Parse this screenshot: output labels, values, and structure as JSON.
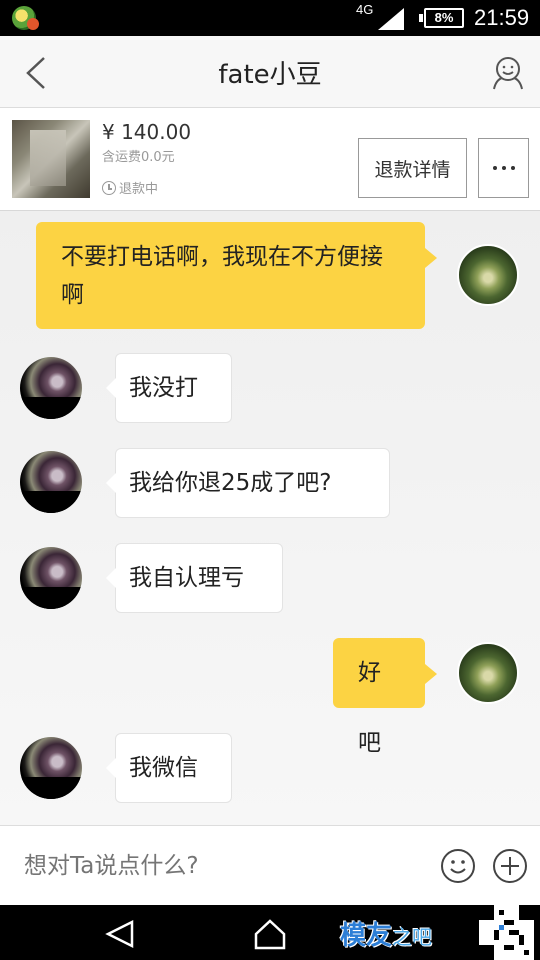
{
  "status_bar": {
    "network": "4G",
    "battery": "8%",
    "time": "21:59"
  },
  "header": {
    "title": "fate小豆"
  },
  "order": {
    "price": "¥ 140.00",
    "shipping": "含运费0.0元",
    "status": "退款中",
    "refund_button": "退款详情"
  },
  "messages": [
    {
      "sender": "me",
      "text": "不要打电话啊，我现在不方便接啊"
    },
    {
      "sender": "other",
      "text": "我没打"
    },
    {
      "sender": "other",
      "text": "我给你退25成了吧?"
    },
    {
      "sender": "other",
      "text": "我自认理亏"
    },
    {
      "sender": "me",
      "text": "好吧"
    },
    {
      "sender": "other",
      "text": "我微信"
    }
  ],
  "composer": {
    "placeholder": "想对Ta说点什么?"
  },
  "watermark": {
    "text": "模友",
    "sub": "之吧"
  },
  "colors": {
    "my_bubble": "#fcd343",
    "other_bubble": "#ffffff"
  }
}
